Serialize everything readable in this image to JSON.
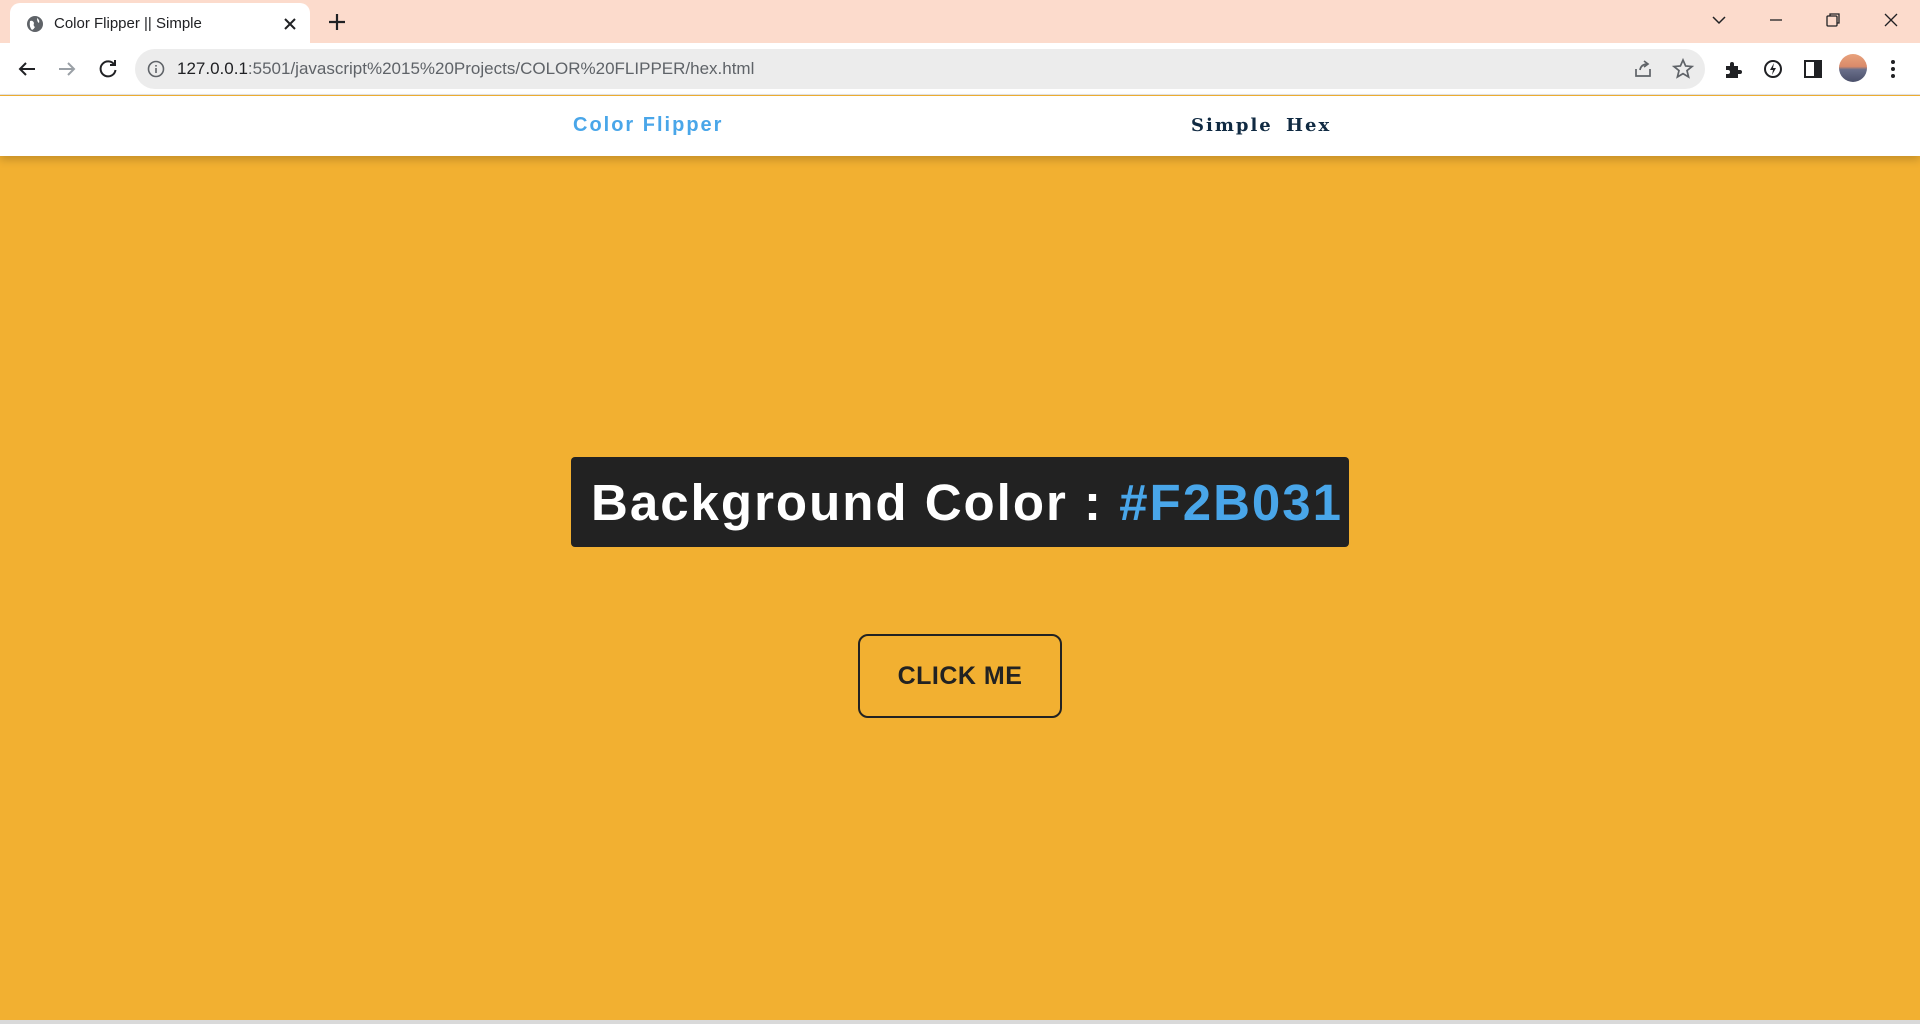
{
  "browser": {
    "tab_title": "Color Flipper || Simple",
    "url_host": "127.0.0.1",
    "url_rest": ":5501/javascript%2015%20Projects/COLOR%20FLIPPER/hex.html",
    "icons": [
      "globe-icon",
      "close-icon",
      "plus-icon",
      "chevron-down-icon",
      "minimize-icon",
      "restore-icon",
      "close-window-icon",
      "back-arrow-icon",
      "forward-arrow-icon",
      "reload-icon",
      "info-icon",
      "share-icon",
      "star-icon",
      "puzzle-icon",
      "sync-icon",
      "sidepanel-icon",
      "avatar",
      "more-vert-icon"
    ]
  },
  "nav": {
    "brand": "Color Flipper",
    "links": [
      "Simple",
      "Hex"
    ]
  },
  "main": {
    "label": "Background Color : ",
    "hex": "#F2B031",
    "button": "CLICK ME"
  },
  "colors": {
    "page_background": "#F2B031",
    "panel": "#222222",
    "accent_blue": "#49A6E9",
    "nav_text": "#102A42",
    "tabbar": "#FCDBCC"
  }
}
